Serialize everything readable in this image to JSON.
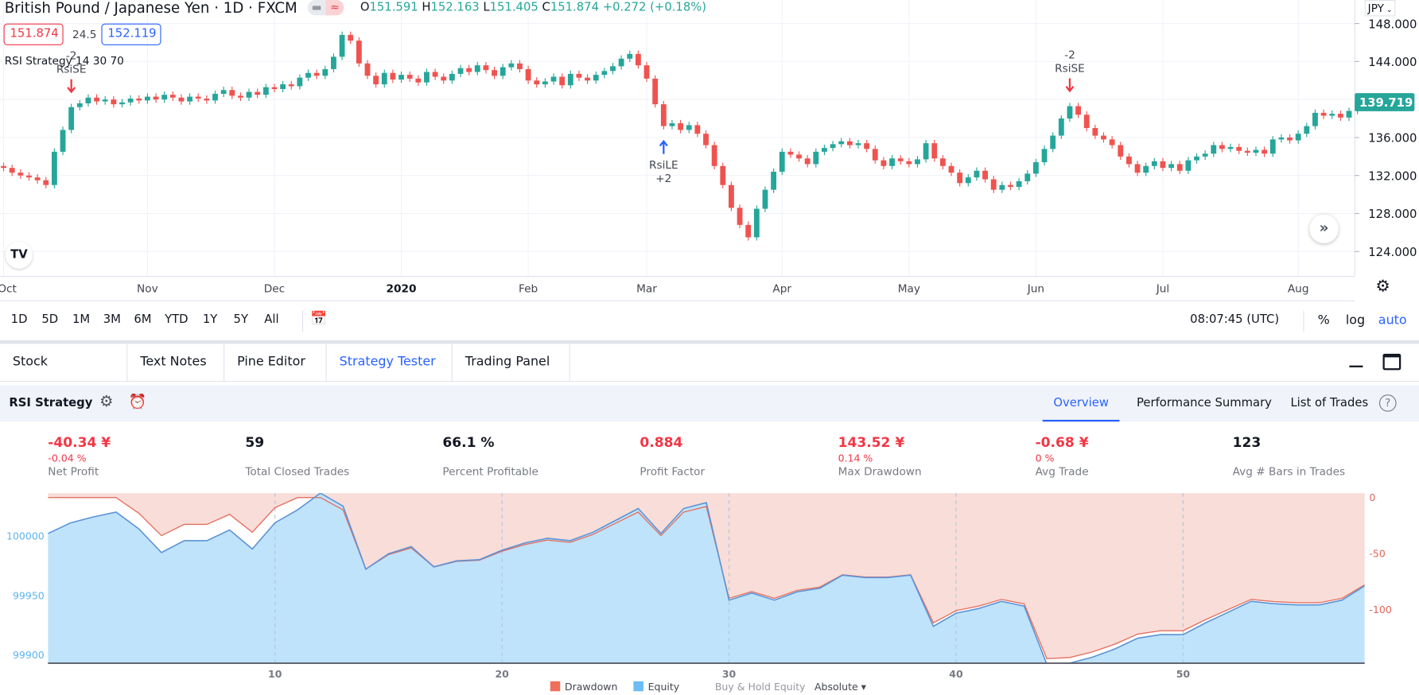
{
  "header": {
    "symbol_title": "British Pound / Japanese Yen · 1D · FXCM",
    "ohlc": {
      "o_label": "O",
      "o": "151.591",
      "h_label": "H",
      "h": "152.163",
      "l_label": "L",
      "l": "151.405",
      "c_label": "C",
      "c": "151.874",
      "change": "+0.272 (+0.18%)"
    },
    "sell_price": "151.874",
    "spread": "24.5",
    "buy_price": "152.119",
    "strategy_legend": "RSI Strategy 14 30 70",
    "currency": "JPY"
  },
  "colors": {
    "up": "#26a69a",
    "down": "#ef5350",
    "accent": "#2962ff",
    "drawdown": "#f8ddd8",
    "equity": "#bfe3fb"
  },
  "price_chart": {
    "y_ticks": [
      "148.000",
      "144.000",
      "136.000",
      "132.000",
      "128.000",
      "124.000"
    ],
    "y_tick_values": [
      148,
      144,
      136,
      132,
      128,
      124
    ],
    "last_price": "139.719",
    "months": [
      {
        "label": "Oct",
        "bar": 0
      },
      {
        "label": "Nov",
        "bar": 17
      },
      {
        "label": "Dec",
        "bar": 32
      },
      {
        "label": "2020",
        "bar": 47,
        "bold": true
      },
      {
        "label": "Feb",
        "bar": 62
      },
      {
        "label": "Mar",
        "bar": 76
      },
      {
        "label": "Apr",
        "bar": 92
      },
      {
        "label": "May",
        "bar": 107
      },
      {
        "label": "Jun",
        "bar": 122
      },
      {
        "label": "Jul",
        "bar": 137
      },
      {
        "label": "Aug",
        "bar": 153
      }
    ],
    "first_open": 133.0,
    "closes": [
      132.8,
      132.3,
      132.0,
      131.8,
      131.5,
      131.0,
      134.5,
      136.8,
      139.2,
      139.6,
      140.2,
      139.8,
      140.0,
      139.5,
      139.7,
      140.1,
      139.9,
      140.3,
      140.0,
      140.5,
      140.2,
      139.8,
      140.3,
      140.1,
      139.9,
      140.6,
      141.0,
      140.4,
      140.2,
      140.8,
      140.5,
      141.3,
      141.1,
      141.6,
      141.4,
      142.3,
      142.8,
      142.5,
      143.2,
      144.5,
      146.8,
      146.2,
      143.8,
      142.5,
      141.6,
      142.8,
      142.1,
      142.6,
      142.2,
      141.8,
      142.9,
      142.4,
      142.0,
      142.7,
      143.3,
      142.9,
      143.6,
      143.1,
      142.5,
      143.4,
      143.8,
      143.2,
      142.0,
      141.6,
      141.9,
      142.4,
      141.5,
      142.7,
      142.3,
      142.0,
      142.6,
      143.0,
      143.5,
      144.3,
      144.8,
      143.6,
      142.2,
      139.5,
      137.2,
      137.5,
      136.8,
      137.3,
      136.4,
      135.2,
      133.0,
      131.0,
      128.6,
      126.8,
      125.5,
      128.5,
      130.5,
      132.4,
      134.5,
      134.2,
      133.8,
      133.2,
      134.5,
      134.9,
      135.3,
      135.6,
      135.2,
      135.4,
      134.8,
      133.6,
      133.0,
      133.8,
      133.5,
      133.2,
      133.7,
      135.4,
      133.8,
      133.0,
      132.3,
      131.2,
      131.8,
      132.5,
      131.6,
      130.5,
      131.0,
      130.8,
      131.4,
      132.2,
      133.4,
      134.8,
      136.2,
      138.0,
      139.3,
      138.4,
      137.0,
      136.2,
      135.8,
      135.2,
      134.0,
      133.2,
      132.3,
      133.0,
      133.5,
      132.8,
      133.2,
      132.5,
      133.6,
      134.0,
      134.3,
      135.2,
      134.8,
      135.0,
      134.6,
      134.4,
      134.7,
      134.3,
      135.8,
      136.0,
      135.7,
      136.4,
      137.2,
      138.6,
      138.3,
      138.5,
      138.1,
      138.8,
      139.719
    ],
    "signals": [
      {
        "type": "short",
        "bar": 8,
        "label": "RsiSE",
        "qty": "-2"
      },
      {
        "type": "long",
        "bar": 78,
        "label": "RsiLE",
        "qty": "+2"
      },
      {
        "type": "short",
        "bar": 126,
        "label": "RsiSE",
        "qty": "-2"
      }
    ]
  },
  "toolbar": {
    "ranges": [
      "1D",
      "5D",
      "1M",
      "3M",
      "6M",
      "YTD",
      "1Y",
      "5Y",
      "All"
    ],
    "clock": "08:07:45 (UTC)",
    "percent": "%",
    "log": "log",
    "auto": "auto"
  },
  "bottom_tabs": [
    {
      "label": "Stock Screener",
      "active": false
    },
    {
      "label": "Text Notes",
      "active": false
    },
    {
      "label": "Pine Editor",
      "active": false
    },
    {
      "label": "Strategy Tester",
      "active": true
    },
    {
      "label": "Trading Panel",
      "active": false
    }
  ],
  "strategy": {
    "name": "RSI Strategy",
    "tabs": [
      {
        "label": "Overview",
        "active": true
      },
      {
        "label": "Performance Summary",
        "active": false
      },
      {
        "label": "List of Trades",
        "active": false
      }
    ]
  },
  "metrics": [
    {
      "value": "-40.34 ¥",
      "sub": "-0.04 %",
      "label": "Net Profit",
      "negative": true
    },
    {
      "value": "59",
      "sub": "",
      "label": "Total Closed Trades",
      "negative": false
    },
    {
      "value": "66.1 %",
      "sub": "",
      "label": "Percent Profitable",
      "negative": false
    },
    {
      "value": "0.884",
      "sub": "",
      "label": "Profit Factor",
      "negative": true
    },
    {
      "value": "143.52 ¥",
      "sub": "0.14 %",
      "label": "Max Drawdown",
      "negative": true
    },
    {
      "value": "-0.68 ¥",
      "sub": "0 %",
      "label": "Avg Trade",
      "negative": true
    },
    {
      "value": "123",
      "sub": "",
      "label": "Avg # Bars in Trades",
      "negative": false
    }
  ],
  "chart_data": {
    "type": "area",
    "x_ticks": [
      "10",
      "20",
      "30",
      "40",
      "50"
    ],
    "x_tick_values": [
      10,
      20,
      30,
      40,
      50
    ],
    "xlim": [
      0,
      58
    ],
    "left_axis": {
      "ticks": [
        "100000",
        "99950",
        "99900"
      ],
      "values": [
        100000,
        99950,
        99900
      ],
      "ylim": [
        99893,
        100036
      ]
    },
    "right_axis": {
      "ticks": [
        "0",
        "-50",
        "-100"
      ],
      "values": [
        0,
        -50,
        -100
      ],
      "ylim": [
        -148,
        4
      ]
    },
    "series": [
      {
        "name": "Equity",
        "values": [
          100002,
          100011,
          100016,
          100020,
          100006,
          99986,
          99996,
          99996,
          100005,
          99989,
          100011,
          100022,
          100036,
          100025,
          99972,
          99985,
          99991,
          99974,
          99979,
          99980,
          99988,
          99994,
          99998,
          99996,
          100003,
          100013,
          100023,
          100002,
          100023,
          100028,
          99946,
          99952,
          99946,
          99953,
          99956,
          99967,
          99965,
          99965,
          99967,
          99924,
          99935,
          99939,
          99945,
          99941,
          99892,
          99893,
          99898,
          99905,
          99914,
          99917,
          99917,
          99927,
          99936,
          99945,
          99943,
          99942,
          99942,
          99946,
          99958
        ]
      },
      {
        "name": "Drawdown",
        "values": [
          0,
          0,
          0,
          0,
          14,
          34,
          24,
          24,
          15,
          31,
          9,
          0,
          0,
          11,
          64,
          51,
          45,
          62,
          57,
          56,
          48,
          42,
          38,
          40,
          33,
          23,
          13,
          34,
          13,
          8,
          90,
          84,
          90,
          83,
          80,
          69,
          71,
          71,
          69,
          112,
          101,
          97,
          91,
          95,
          144,
          143,
          138,
          131,
          122,
          119,
          119,
          109,
          100,
          91,
          93,
          94,
          94,
          90,
          78
        ]
      }
    ],
    "legend": [
      {
        "label": "Drawdown",
        "color": "#ef6f5c"
      },
      {
        "label": "Equity",
        "color": "#6cbcf5"
      },
      {
        "label": "Buy & Hold Equity",
        "color": ""
      }
    ],
    "mode": "Absolute"
  }
}
